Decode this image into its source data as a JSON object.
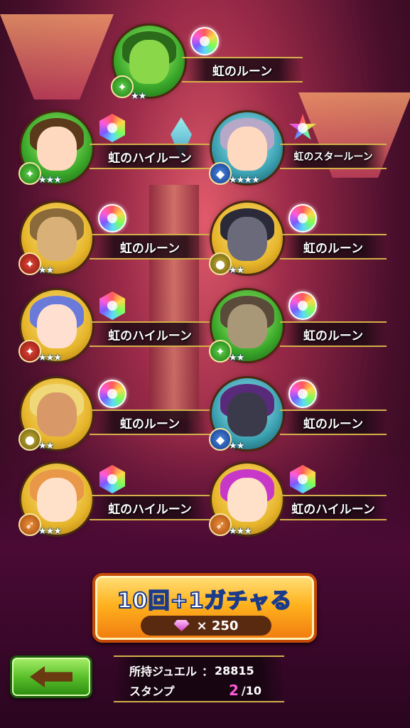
{
  "rewards": [
    {
      "rune": "虹のルーン",
      "stars": "★★",
      "element": "wind",
      "rune_shape": "drop",
      "portrait": "green"
    },
    {
      "rune": "虹のハイルーン",
      "stars": "★★★",
      "element": "wind",
      "rune_shape": "hex",
      "portrait": "green"
    },
    {
      "rune": "虹のスタールーン",
      "stars": "★★★★",
      "element": "water",
      "rune_shape": "star",
      "portrait": "teal"
    },
    {
      "rune": "虹のルーン",
      "stars": "★★",
      "element": "fire",
      "rune_shape": "drop",
      "portrait": "gold"
    },
    {
      "rune": "虹のルーン",
      "stars": "★★",
      "element": "earth",
      "rune_shape": "drop",
      "portrait": "gold"
    },
    {
      "rune": "虹のハイルーン",
      "stars": "★★★",
      "element": "fire",
      "rune_shape": "hex",
      "portrait": "gold"
    },
    {
      "rune": "虹のルーン",
      "stars": "★★",
      "element": "wind",
      "rune_shape": "drop",
      "portrait": "green"
    },
    {
      "rune": "虹のルーン",
      "stars": "★★",
      "element": "earth",
      "rune_shape": "drop",
      "portrait": "gold"
    },
    {
      "rune": "虹のルーン",
      "stars": "★★",
      "element": "water",
      "rune_shape": "drop",
      "portrait": "teal"
    },
    {
      "rune": "虹のハイルーン",
      "stars": "★★★",
      "element": "light",
      "rune_shape": "hex",
      "portrait": "gold"
    },
    {
      "rune": "虹のハイルーン",
      "stars": "★★★",
      "element": "light",
      "rune_shape": "hex",
      "portrait": "gold"
    }
  ],
  "gacha_button": {
    "title": "10回+1ガチャる",
    "cost_icon": "gem-icon",
    "cost": "× 250"
  },
  "back_button": {
    "icon": "arrow-left-icon"
  },
  "info": {
    "jewel_label": "所持ジュエル",
    "jewel_sep": "：",
    "jewel_value": "28815",
    "stamp_label": "スタンプ",
    "stamp_current": "2",
    "stamp_total": "/10"
  },
  "colors": {
    "accent_gold": "#d4b04a",
    "button_orange": "#ffb21e",
    "back_green": "#5ac02a"
  }
}
